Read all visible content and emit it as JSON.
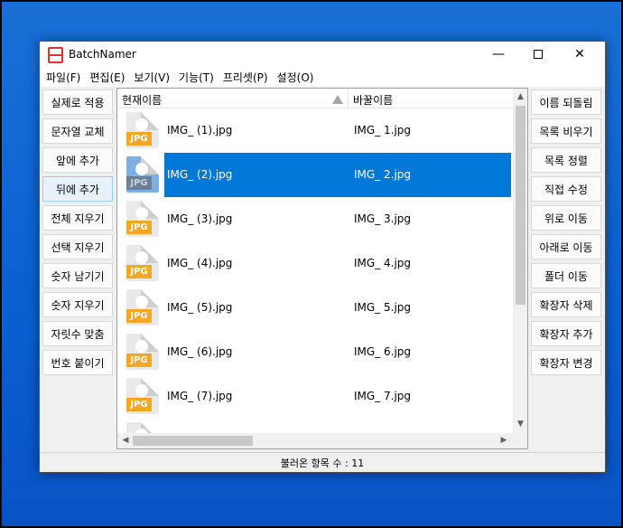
{
  "window": {
    "title": "BatchNamer"
  },
  "menu": [
    "파일(F)",
    "편집(E)",
    "보기(V)",
    "기능(T)",
    "프리셋(P)",
    "설정(O)"
  ],
  "left_buttons": [
    "실제로 적용",
    "문자열 교체",
    "앞에 추가",
    "뒤에 추가",
    "전체 지우기",
    "선택 지우기",
    "숫자 남기기",
    "숫자 지우기",
    "자릿수 맞춤",
    "번호 붙이기"
  ],
  "right_buttons": [
    "이름 되돌림",
    "목록 비우기",
    "목록 정렬",
    "직접 수정",
    "위로 이동",
    "아래로 이동",
    "폴더 이동",
    "확장자 삭제",
    "확장자 추가",
    "확장자 변경"
  ],
  "list": {
    "col_current": "현재이름",
    "col_new": "바꿀이름",
    "icon_label": "JPG",
    "rows": [
      {
        "current": "IMG_ (1).jpg",
        "new": "IMG_ 1.jpg"
      },
      {
        "current": "IMG_ (2).jpg",
        "new": "IMG_ 2.jpg"
      },
      {
        "current": "IMG_ (3).jpg",
        "new": "IMG_ 3.jpg"
      },
      {
        "current": "IMG_ (4).jpg",
        "new": "IMG_ 4.jpg"
      },
      {
        "current": "IMG_ (5).jpg",
        "new": "IMG_ 5.jpg"
      },
      {
        "current": "IMG_ (6).jpg",
        "new": "IMG_ 6.jpg"
      },
      {
        "current": "IMG_ (7).jpg",
        "new": "IMG_ 7.jpg"
      }
    ]
  },
  "status": "불러온 항목 수 : 11",
  "colors": {
    "selection": "#0078d7",
    "jpg_badge": "#f5a623",
    "desktop": "#0a5fd0"
  }
}
